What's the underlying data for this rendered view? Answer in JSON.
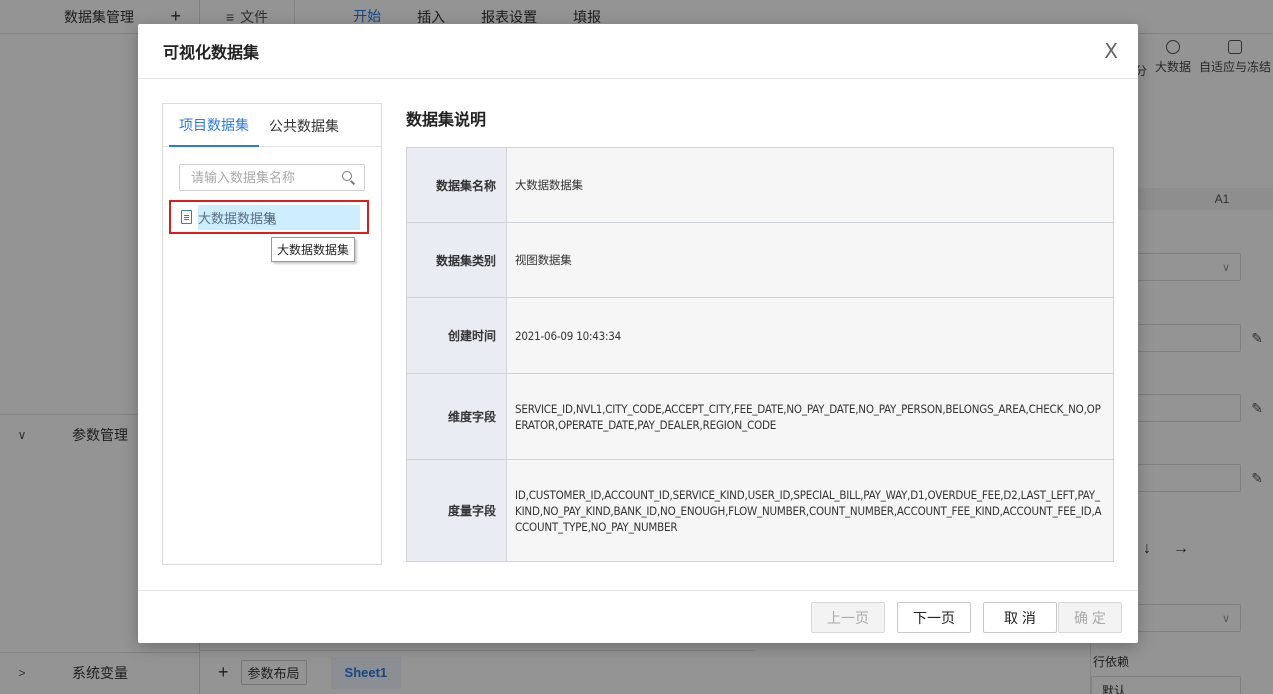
{
  "background": {
    "left_header": "数据集管理",
    "param_section": "参数管理",
    "sysvar_section": "系统变量",
    "file_menu": "文件",
    "menu_tabs": [
      "开始",
      "插入",
      "报表设置",
      "填报"
    ],
    "ribbon": [
      "分",
      "大数据",
      "自适应与冻结"
    ],
    "cell_ref": "A1",
    "row_depend_label": "行依赖",
    "row_depend_value": "默认",
    "param_layout_button": "参数布局",
    "sheet_tab": "Sheet1"
  },
  "dialog": {
    "title": "可视化数据集",
    "tabs": [
      "项目数据集",
      "公共数据集"
    ],
    "search_placeholder": "请输入数据集名称",
    "selected_item": "大数据数据集",
    "tooltip": "大数据数据集",
    "detail_title": "数据集说明",
    "fields": [
      {
        "key": "数据集名称",
        "value": "大数据数据集"
      },
      {
        "key": "数据集类别",
        "value": "视图数据集"
      },
      {
        "key": "创建时间",
        "value": "2021-06-09 10:43:34"
      },
      {
        "key": "维度字段",
        "value": "SERVICE_ID,NVL1,CITY_CODE,ACCEPT_CITY,FEE_DATE,NO_PAY_DATE,NO_PAY_PERSON,BELONGS_AREA,CHECK_NO,OPERATOR,OPERATE_DATE,PAY_DEALER,REGION_CODE"
      },
      {
        "key": "度量字段",
        "value": "ID,CUSTOMER_ID,ACCOUNT_ID,SERVICE_KIND,USER_ID,SPECIAL_BILL,PAY_WAY,D1,OVERDUE_FEE,D2,LAST_LEFT,PAY_KIND,NO_PAY_KIND,BANK_ID,NO_ENOUGH,FLOW_NUMBER,COUNT_NUMBER,ACCOUNT_FEE_KIND,ACCOUNT_FEE_ID,ACCOUNT_TYPE,NO_PAY_NUMBER"
      }
    ],
    "buttons": {
      "prev": "上一页",
      "next": "下一页",
      "cancel": "取 消",
      "ok": "确 定"
    }
  }
}
